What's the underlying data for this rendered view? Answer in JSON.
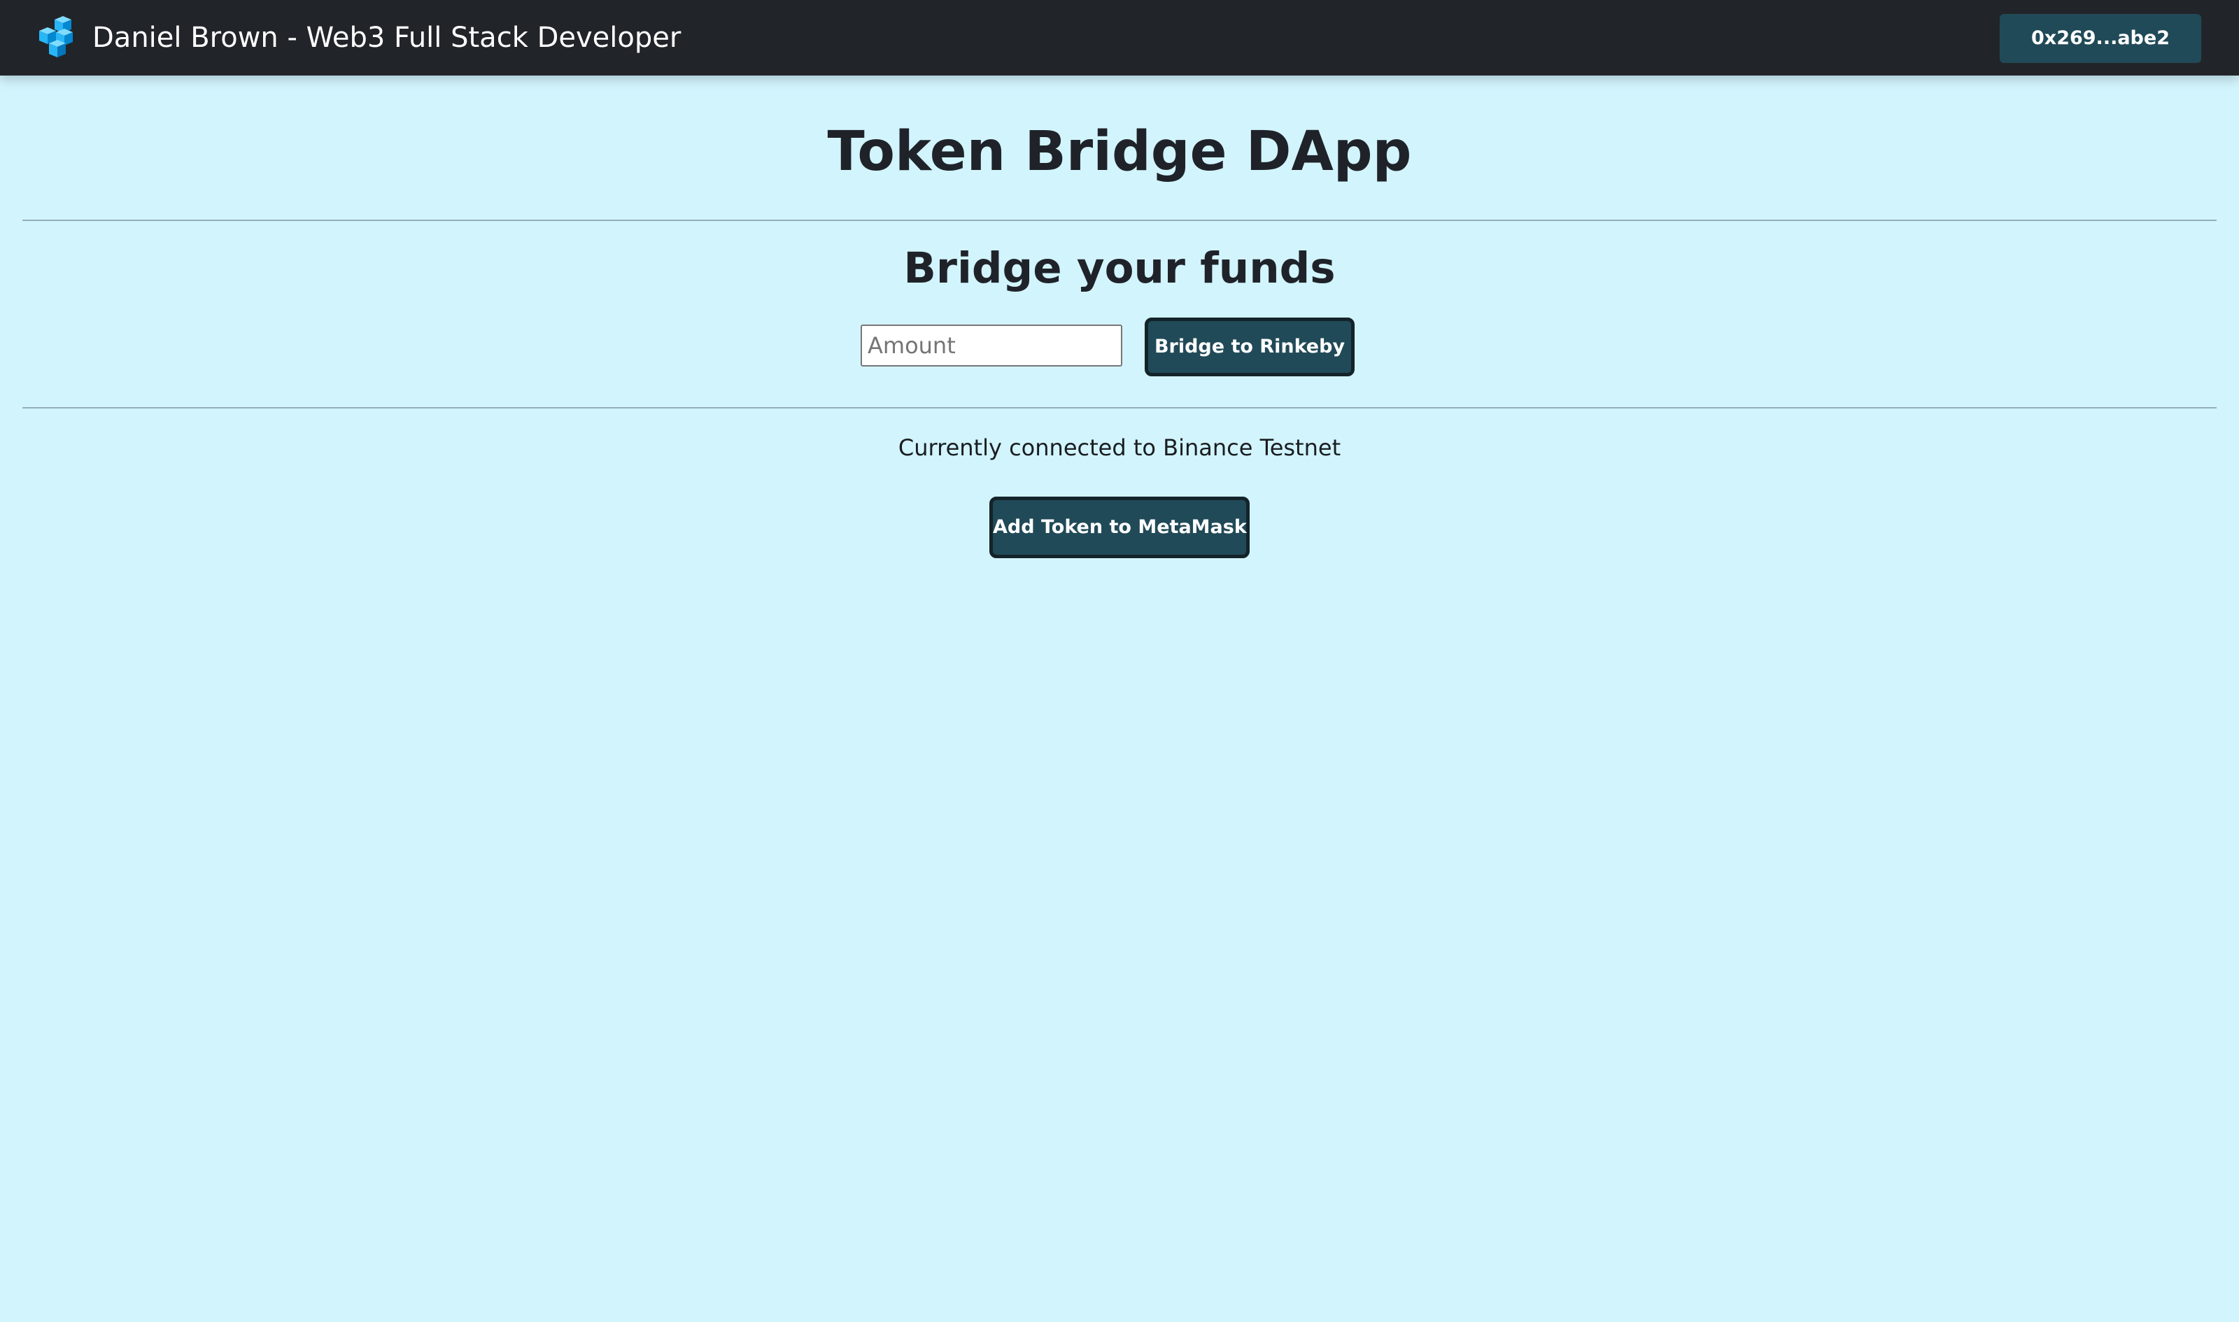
{
  "navbar": {
    "logo_icon": "blue-cubes-logo-icon",
    "brand_title": "Daniel Brown - Web3 Full Stack Developer",
    "wallet_label": "0x269...abe2"
  },
  "main": {
    "title": "Token Bridge DApp",
    "bridge_heading": "Bridge your funds",
    "amount_input": {
      "value": "",
      "placeholder": "Amount"
    },
    "bridge_button_label": "Bridge to Rinkeby",
    "network_status": "Currently connected to Binance Testnet",
    "add_token_button_label": "Add Token to MetaMask"
  },
  "colors": {
    "page_background": "#d2f4fd",
    "navbar_background": "#212529",
    "button_background": "#214a58",
    "button_border": "#14232a",
    "logo_blue": "#29b6f6"
  }
}
